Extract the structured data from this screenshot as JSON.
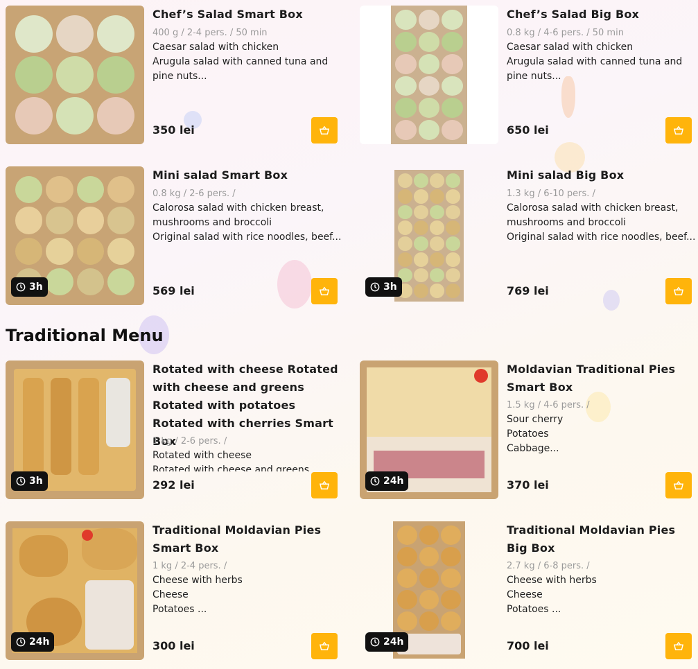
{
  "section": {
    "title": "Traditional Menu"
  },
  "colors": {
    "accent": "#ffb40b",
    "badge": "#111111",
    "meta": "#9a9a9a"
  },
  "icons": {
    "cart": "basket-icon",
    "time": "clock-icon"
  },
  "products": [
    {
      "title": "Chef’s Salad Smart Box",
      "meta": "400 g / 2-4 pers. / 50 min",
      "lines": [
        "Caesar salad with chicken",
        "Arugula salad with canned tuna and",
        "pine nuts..."
      ],
      "price": "350 lei",
      "badge": ""
    },
    {
      "title": "Chef’s Salad Big Box",
      "meta": "0.8 kg / 4-6 pers. / 50 min",
      "lines": [
        "Caesar salad with chicken",
        "Arugula salad with canned tuna and",
        "pine nuts..."
      ],
      "price": "650 lei",
      "badge": ""
    },
    {
      "title": "Mini salad Smart Box",
      "meta": "0.8 kg / 2-6 pers. /",
      "lines": [
        "Calorosa salad with chicken breast,",
        "mushrooms and broccoli",
        "Original salad with rice noodles, beef..."
      ],
      "price": "569 lei",
      "badge": "3h"
    },
    {
      "title": "Mini salad Big Box",
      "meta": "1.3 kg / 6-10 pers. /",
      "lines": [
        "Calorosa salad with chicken breast,",
        "mushrooms and broccoli",
        "Original salad with rice noodles, beef..."
      ],
      "price": "769 lei",
      "badge": "3h"
    },
    {
      "title": "Rotated with cheese Rotated with cheese and greens Rotated with potatoes Rotated with cherries Smart Box",
      "meta": "1 kg / 2-6 pers. /",
      "lines": [
        "Rotated with cheese",
        "Rotated with cheese and greens"
      ],
      "price": "292 lei",
      "badge": "3h"
    },
    {
      "title": "Moldavian Traditional Pies Smart Box",
      "meta": "1.5 kg / 4-6 pers. /",
      "lines": [
        "Sour cherry",
        "Potatoes",
        "Cabbage..."
      ],
      "price": "370 lei",
      "badge": "24h"
    },
    {
      "title": "Traditional Moldavian Pies Smart Box",
      "meta": "1 kg / 2-4 pers. /",
      "lines": [
        "Cheese with herbs",
        "Cheese",
        "Potatoes ..."
      ],
      "price": "300 lei",
      "badge": "24h"
    },
    {
      "title": "Traditional Moldavian Pies Big Box",
      "meta": "2.7 kg / 6-8 pers. /",
      "lines": [
        "Cheese with herbs",
        "Cheese",
        "Potatoes ..."
      ],
      "price": "700 lei",
      "badge": "24h"
    }
  ]
}
